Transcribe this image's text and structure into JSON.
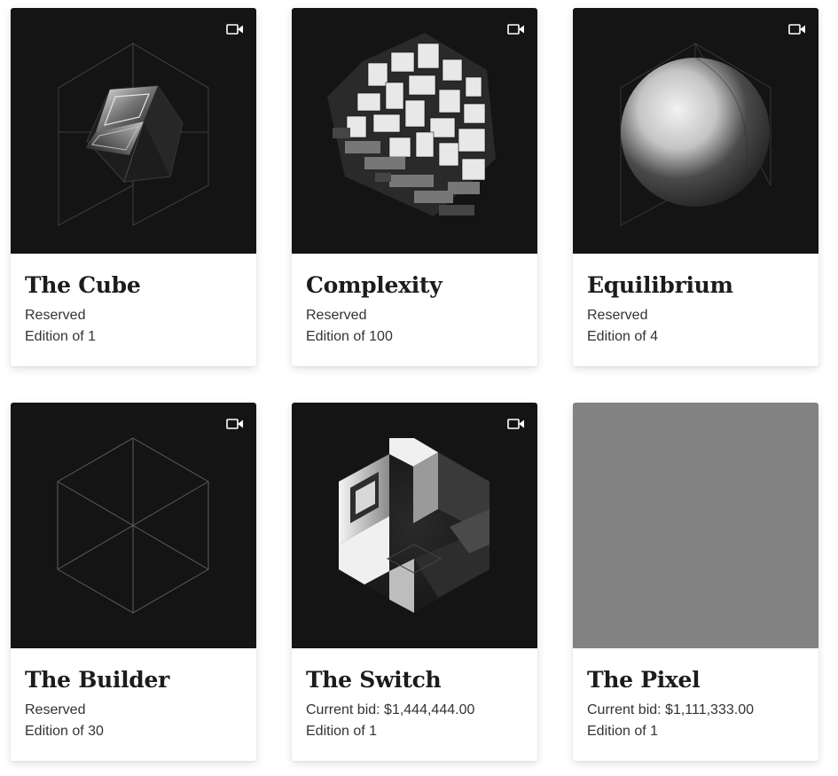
{
  "cards": [
    {
      "title": "The Cube",
      "status": "Reserved",
      "edition": "Edition of 1",
      "has_video": true,
      "art": "cube-glass"
    },
    {
      "title": "Complexity",
      "status": "Reserved",
      "edition": "Edition of 100",
      "has_video": true,
      "art": "voxel-cluster"
    },
    {
      "title": "Equilibrium",
      "status": "Reserved",
      "edition": "Edition of 4",
      "has_video": true,
      "art": "sphere"
    },
    {
      "title": "The Builder",
      "status": "Reserved",
      "edition": "Edition of 30",
      "has_video": true,
      "art": "wireframe-cube"
    },
    {
      "title": "The Switch",
      "status": "Current bid: $1,444,444.00",
      "edition": "Edition of 1",
      "has_video": true,
      "art": "carved-cube"
    },
    {
      "title": "The Pixel",
      "status": "Current bid: $1,111,333.00",
      "edition": "Edition of 1",
      "has_video": false,
      "art": "gray-pixel"
    }
  ],
  "colors": {
    "art_background": "#141414",
    "pixel_gray": "#828282",
    "title_text": "#1c1c1c",
    "body_text": "#333333"
  },
  "icons": {
    "video": "video-camera-icon"
  }
}
